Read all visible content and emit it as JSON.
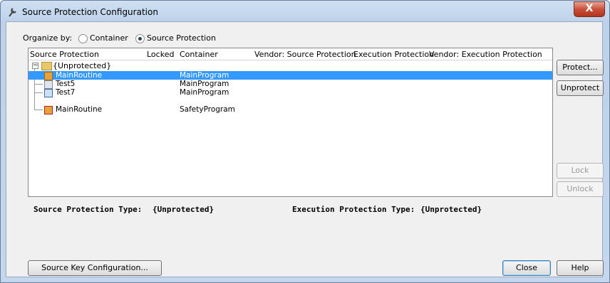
{
  "window": {
    "title": "Source Protection Configuration",
    "close_glyph": "X"
  },
  "organize": {
    "label": "Organize by:",
    "options": [
      {
        "label": "Container",
        "selected": false
      },
      {
        "label": "Source Protection",
        "selected": true
      }
    ]
  },
  "table": {
    "columns": [
      "Source Protection",
      "Locked",
      "Container",
      "Vendor: Source Protection",
      "Execution Protection",
      "Vendor: Execution Protection"
    ],
    "group": "{Unprotected}",
    "rows": [
      {
        "name": "MainRoutine",
        "container": "MainProgram",
        "selected": true
      },
      {
        "name": "Test5",
        "container": "MainProgram",
        "selected": false
      },
      {
        "name": "Test7",
        "container": "MainProgram",
        "selected": false
      },
      {
        "name": "MainRoutine",
        "container": "SafetyProgram",
        "selected": false
      }
    ]
  },
  "buttons": {
    "protect": "Protect...",
    "unprotect": "Unprotect",
    "lock": "Lock",
    "unlock": "Unlock",
    "source_key": "Source Key Configuration...",
    "close": "Close",
    "help": "Help"
  },
  "status": {
    "source_type_label": "Source Protection Type:",
    "source_type_value": "{Unprotected}",
    "exec_type_label": "Execution Protection Type:",
    "exec_type_value": "{Unprotected}"
  },
  "colors": {
    "selection": "#3399ff",
    "title_close": "#c9503a"
  }
}
